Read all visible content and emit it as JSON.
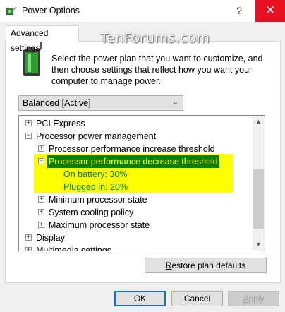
{
  "window": {
    "title": "Power Options",
    "help_glyph": "?",
    "close_glyph": "✕"
  },
  "watermark": "TenForums.com",
  "tab": {
    "label": "Advanced settings"
  },
  "intro_text": "Select the power plan that you want to customize, and then choose settings that reflect how you want your computer to manage power.",
  "plan_dropdown": {
    "selected": "Balanced [Active]"
  },
  "tree": [
    {
      "label": "PCI Express",
      "expander": "+"
    },
    {
      "label": "Processor power management",
      "expander": "−"
    },
    {
      "label": "Processor performance increase threshold",
      "expander": "+"
    },
    {
      "label": "Processor performance decrease threshold",
      "expander": "−"
    },
    {
      "label": "On battery:",
      "value": "30%"
    },
    {
      "label": "Plugged in:",
      "value": "20%"
    },
    {
      "label": "Minimum processor state",
      "expander": "+"
    },
    {
      "label": "System cooling policy",
      "expander": "+"
    },
    {
      "label": "Maximum processor state",
      "expander": "+"
    },
    {
      "label": "Display",
      "expander": "+"
    },
    {
      "label": "Multimedia settings",
      "expander": "+"
    }
  ],
  "buttons": {
    "restore_first": "R",
    "restore_rest": "estore plan defaults",
    "ok": "OK",
    "cancel": "Cancel",
    "apply_first": "A",
    "apply_rest": "pply"
  },
  "colors": {
    "close": "#e81123",
    "highlight": "#ffff00",
    "selection": "#008000"
  }
}
